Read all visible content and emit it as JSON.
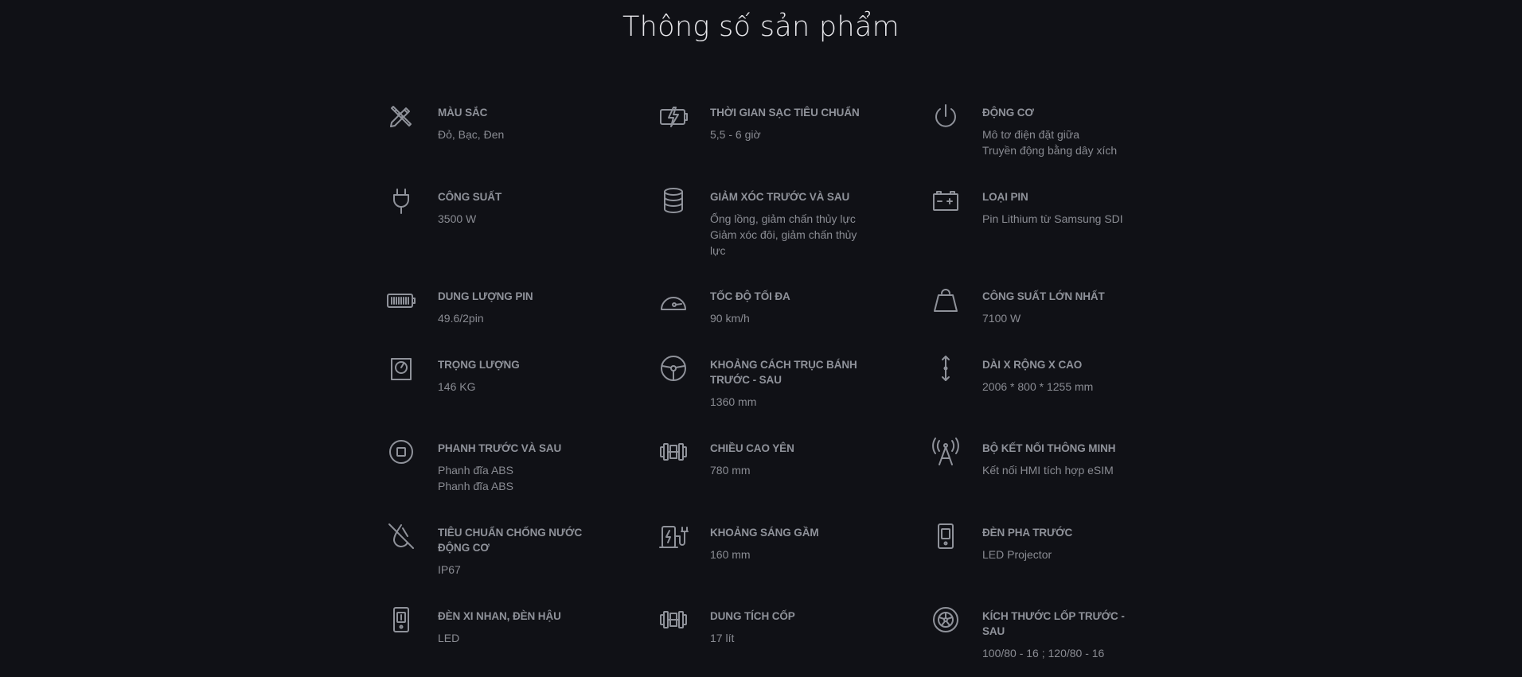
{
  "page": {
    "title": "Thông số sản phẩm"
  },
  "specs": [
    {
      "icon": "paint-brush-icon",
      "label": "MÀU SẮC",
      "values": [
        "Đỏ, Bạc, Đen"
      ]
    },
    {
      "icon": "charging-battery-icon",
      "label": "THỜI GIAN SẠC TIÊU CHUẨN",
      "values": [
        "5,5 - 6 giờ"
      ]
    },
    {
      "icon": "power-icon",
      "label": "ĐỘNG CƠ",
      "values": [
        "Mô tơ điện đặt giữa",
        "Truyền động bằng dây xích"
      ]
    },
    {
      "icon": "plug-icon",
      "label": "CÔNG SUẤT",
      "values": [
        "3500 W"
      ]
    },
    {
      "icon": "database-stack-icon",
      "label": "GIẢM XÓC TRƯỚC VÀ SAU",
      "values": [
        "Ống lồng, giảm chấn thủy lực",
        "Giảm xóc đôi, giảm chấn thủy lực"
      ]
    },
    {
      "icon": "car-battery-icon",
      "label": "LOẠI PIN",
      "values": [
        "Pin Lithium từ Samsung SDI"
      ]
    },
    {
      "icon": "battery-level-icon",
      "label": "DUNG LƯỢNG PIN",
      "values": [
        "49.6/2pin"
      ]
    },
    {
      "icon": "speedometer-icon",
      "label": "TỐC ĐỘ TỐI ĐA",
      "values": [
        "90 km/h"
      ]
    },
    {
      "icon": "weight-icon",
      "label": "CÔNG SUẤT LỚN NHẤT",
      "values": [
        "7100 W"
      ]
    },
    {
      "icon": "scale-icon",
      "label": "TRỌNG LƯỢNG",
      "values": [
        "146 KG"
      ]
    },
    {
      "icon": "steering-wheel-icon",
      "label": "KHOẢNG CÁCH TRỤC BÁNH TRƯỚC - SAU",
      "values": [
        "1360 mm"
      ]
    },
    {
      "icon": "vertical-arrows-icon",
      "label": "DÀI X RỘNG X CAO",
      "values": [
        "2006 * 800 * 1255 mm"
      ]
    },
    {
      "icon": "brake-button-icon",
      "label": "PHANH TRƯỚC VÀ SAU",
      "values": [
        "Phanh đĩa ABS",
        "Phanh đĩa ABS"
      ]
    },
    {
      "icon": "dumbbell-icon",
      "label": "CHIỀU CAO YÊN",
      "values": [
        "780 mm"
      ]
    },
    {
      "icon": "antenna-icon",
      "label": "BỘ KẾT NỐI THÔNG MINH",
      "values": [
        "Kết nối HMI tích hợp eSIM"
      ]
    },
    {
      "icon": "no-water-icon",
      "label": "TIÊU CHUẨN CHỐNG NƯỚC ĐỘNG CƠ",
      "values": [
        "IP67"
      ]
    },
    {
      "icon": "charging-station-icon",
      "label": "KHOẢNG SÁNG GẦM",
      "values": [
        "160 mm"
      ]
    },
    {
      "icon": "headlight-icon",
      "label": "ĐÈN PHA TRƯỚC",
      "values": [
        "LED Projector"
      ]
    },
    {
      "icon": "signal-light-icon",
      "label": "ĐÈN XI NHAN, ĐÈN HẬU",
      "values": [
        "LED"
      ]
    },
    {
      "icon": "dumbbell-icon",
      "label": "DUNG TÍCH CỐP",
      "values": [
        "17 lít"
      ]
    },
    {
      "icon": "tire-icon",
      "label": "KÍCH THƯỚC LỐP TRƯỚC - SAU",
      "values": [
        "100/80 - 16 ; 120/80 - 16"
      ]
    }
  ]
}
